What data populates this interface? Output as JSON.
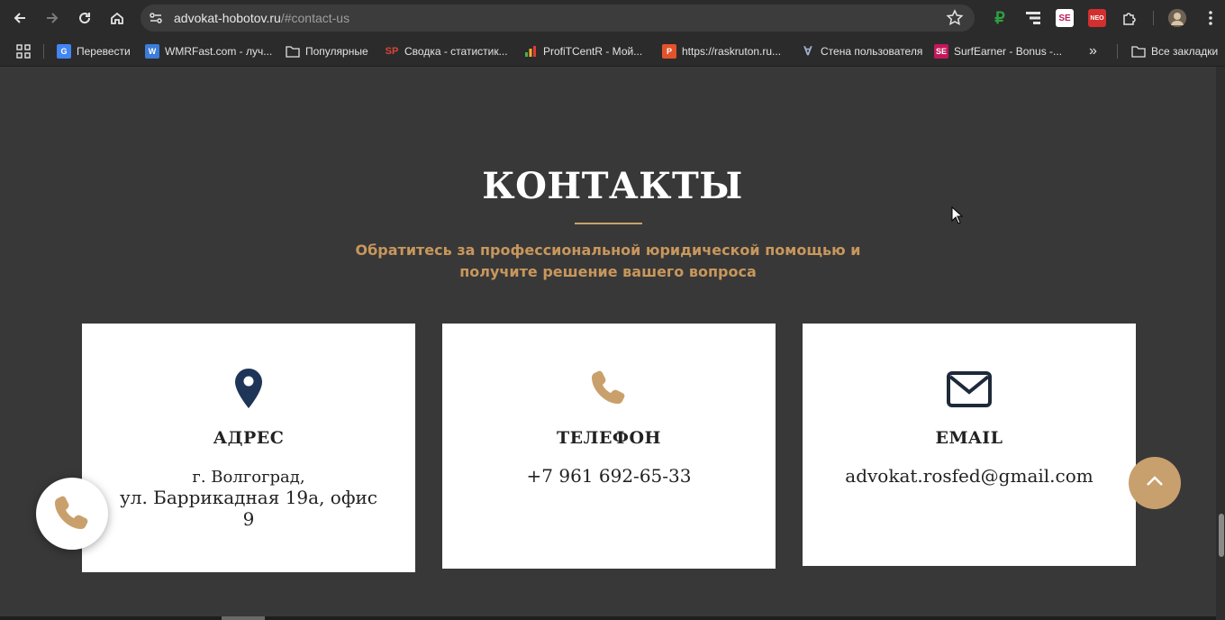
{
  "browser": {
    "url_host": "advokat-hobotov.ru",
    "url_path": "/#contact-us",
    "bookmarks": [
      {
        "label": "Перевести",
        "icon": "google-translate-icon",
        "color": "#4285f4"
      },
      {
        "label": "WMRFast.com - луч...",
        "icon": "wmrfast-icon",
        "color": "#3b7dd8"
      },
      {
        "label": "Популярные",
        "icon": "folder-icon",
        "color": "#e3e3e3"
      },
      {
        "label": "Сводка - статистик...",
        "icon": "sp-icon",
        "color": "#d9443a"
      },
      {
        "label": "ProfiTCentR - Мой...",
        "icon": "profitcentr-icon",
        "color": "#f0b429"
      },
      {
        "label": "https://raskruton.ru...",
        "icon": "raskruton-icon",
        "color": "#e2532c"
      },
      {
        "label": "Стена пользователя",
        "icon": "vk-icon",
        "color": "#a5b4d4"
      },
      {
        "label": "SurfEarner - Bonus -...",
        "icon": "surfearner-icon",
        "color": "#c2185b"
      }
    ],
    "more_bookmarks": "»",
    "all_bookmarks": "Все закладки"
  },
  "contacts": {
    "title": "КОНТАКТЫ",
    "subtitle": "Обратитесь за профессиональной юридической помощью и получите решение вашего вопроса",
    "cards": [
      {
        "title": "АДРЕС",
        "line1": "г. Волгоград,",
        "line2": "ул. Баррикадная 19а, офис 9",
        "icon": "map-pin-icon"
      },
      {
        "title": "ТЕЛЕФОН",
        "text": "+7 961 692-65-33",
        "icon": "phone-icon"
      },
      {
        "title": "EMAIL",
        "text": "advokat.rosfed@gmail.com",
        "icon": "envelope-icon"
      }
    ]
  },
  "colors": {
    "background": "#383838",
    "accent": "#c8a06e",
    "pin": "#1f3557",
    "card": "#ffffff"
  }
}
